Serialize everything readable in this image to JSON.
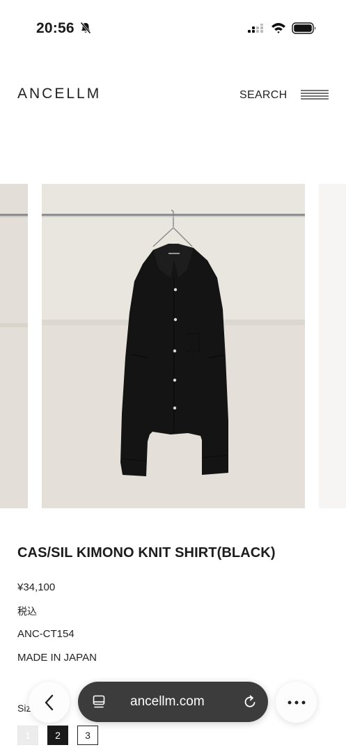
{
  "status_bar": {
    "time": "20:56"
  },
  "header": {
    "brand": "ANCELLM",
    "search_label": "SEARCH"
  },
  "product": {
    "title": "CAS/SIL KIMONO KNIT SHIRT(BLACK)",
    "price": "¥34,100",
    "tax_note": "税込",
    "code": "ANC-CT154",
    "origin": "MADE IN JAPAN",
    "size_label": "Siz",
    "sizes": [
      {
        "label": "1",
        "state": "unavailable"
      },
      {
        "label": "2",
        "state": "selected"
      },
      {
        "label": "3",
        "state": "available"
      }
    ]
  },
  "browser": {
    "url": "ancellm.com"
  },
  "colors": {
    "background": "#ffffff",
    "text": "#1a1a1a",
    "photo_backdrop": "#e6e2dc",
    "garment": "#141414",
    "address_bar": "#3c3c3c"
  },
  "icons": [
    "bell-slash-icon",
    "cellular-signal-icon",
    "wifi-icon",
    "battery-icon",
    "hamburger-menu-icon",
    "chevron-left-icon",
    "tabs-icon",
    "reload-icon",
    "more-dots-icon"
  ]
}
